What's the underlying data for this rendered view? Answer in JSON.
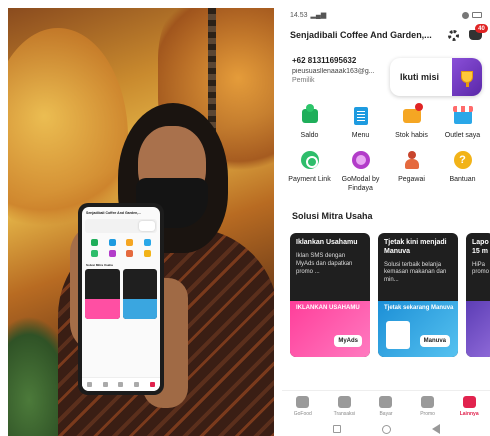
{
  "statusbar": {
    "time": "14.53"
  },
  "header": {
    "store_name": "Senjadibali Coffee And Garden,...",
    "notification_count": "40"
  },
  "profile": {
    "phone": "+62 81311695632",
    "email": "pieusuasllenaaak163@g...",
    "role": "Pemilik",
    "mission_label": "Ikuti misi"
  },
  "menu": [
    {
      "label": "Saldo",
      "icon": "wallet-icon"
    },
    {
      "label": "Menu",
      "icon": "menu-book-icon"
    },
    {
      "label": "Stok habis",
      "icon": "box-icon"
    },
    {
      "label": "Outlet saya",
      "icon": "store-icon"
    },
    {
      "label": "Payment Link",
      "icon": "link-icon"
    },
    {
      "label": "GoModal by Findaya",
      "icon": "money-bag-icon"
    },
    {
      "label": "Pegawai",
      "icon": "employee-icon"
    },
    {
      "label": "Bantuan",
      "icon": "help-icon"
    }
  ],
  "section": {
    "title": "Solusi Mitra Usaha"
  },
  "promos": [
    {
      "title": "Iklankan Usahamu",
      "desc": "Iklan SMS dengan MyAds dan dapatkan promo ...",
      "tag": "MyAds",
      "banner": "IKLANKAN USAHAMU"
    },
    {
      "title": "Tjetak kini menjadi Manuva",
      "desc": "Solusi terbaik belanja kemasan makanan dan min...",
      "tag": "Manuva",
      "banner": "Tjetak sekarang Manuva"
    },
    {
      "title": "Lapo 15 m",
      "desc": "HiPa promo",
      "tag": "",
      "banner": ""
    }
  ],
  "nav": [
    {
      "label": "GoFood",
      "icon": "gofood-icon",
      "active": false
    },
    {
      "label": "Transaksi",
      "icon": "transaction-icon",
      "active": false
    },
    {
      "label": "Bayar",
      "icon": "pay-icon",
      "active": false
    },
    {
      "label": "Promo",
      "icon": "promo-icon",
      "active": false
    },
    {
      "label": "Lainnya",
      "icon": "more-icon",
      "active": true
    }
  ],
  "colors": {
    "accent": "#e1234e",
    "badge": "#e02424",
    "mission_purple": "#6a35b8"
  }
}
